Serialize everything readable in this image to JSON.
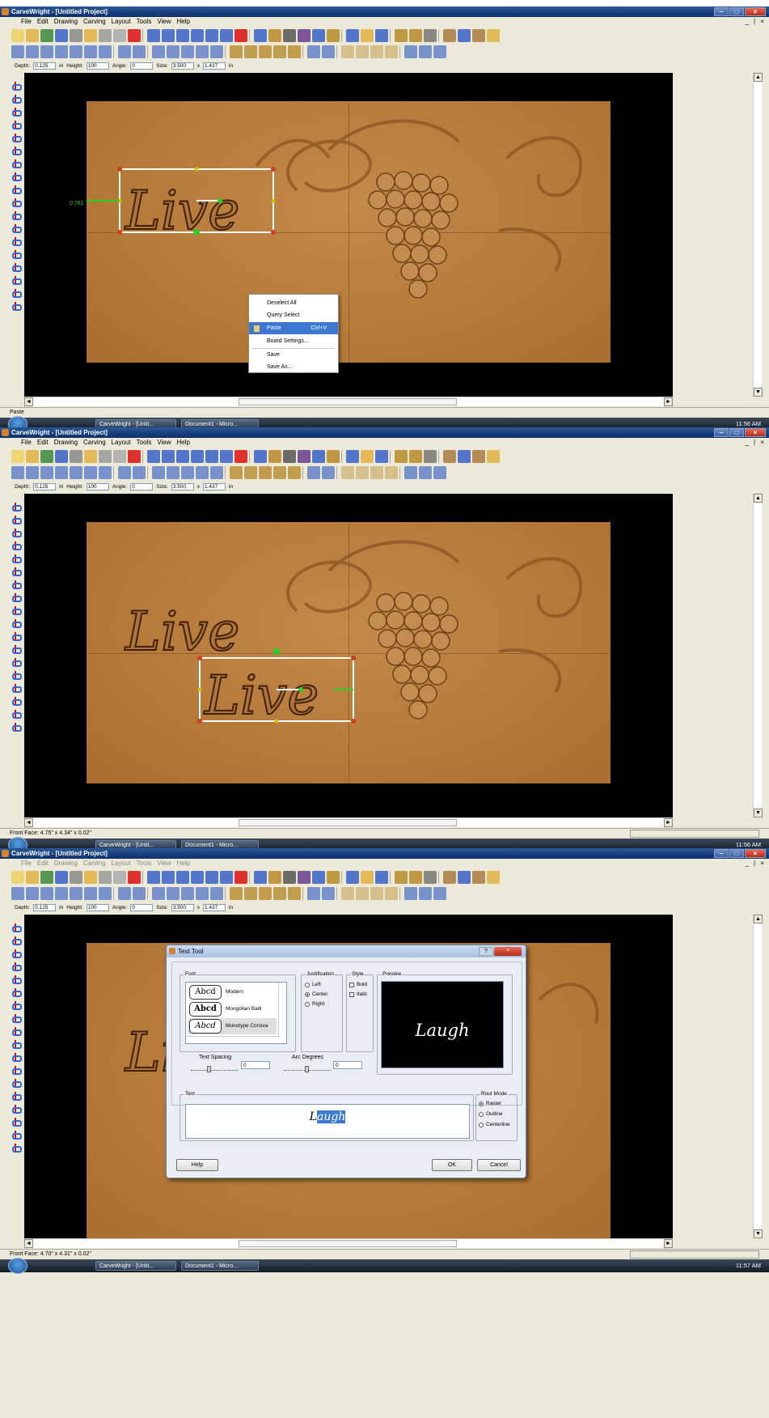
{
  "app": {
    "title": "CarveWright - [Untitled Project]",
    "menus": [
      "File",
      "Edit",
      "Drawing",
      "Carving",
      "Layout",
      "Tools",
      "View",
      "Help"
    ],
    "mdi_controls": "_ | × ",
    "win_min": "‒",
    "win_max": "□",
    "win_close": "×"
  },
  "propbar": {
    "depth_label": "Depth:",
    "depth_value": "0.125",
    "depth_unit": "in",
    "height_label": "Height:",
    "height_value": "100",
    "angle_label": "Angle:",
    "angle_value": "0",
    "size_label": "Size:",
    "size_w": "3.500",
    "size_x": "x",
    "size_h": "1.437",
    "size_unit": "in"
  },
  "panel1": {
    "measure_label": "0.761",
    "board_text": "Live",
    "context_menu": [
      {
        "label": "Deselect All"
      },
      {
        "label": "Query Select"
      },
      {
        "label": "Paste",
        "shortcut": "Ctrl+V"
      },
      {
        "label": "Board Settings..."
      },
      {
        "label": "Save"
      },
      {
        "label": "Save As..."
      }
    ],
    "status": "Paste",
    "clock": "11:56 AM"
  },
  "panel2": {
    "board_text_1": "Live",
    "board_text_2": "Live",
    "status": "Front Face: 4.75\" x 4.34\" x 0.02\"",
    "clock": "11:56 AM"
  },
  "panel3": {
    "board_text": "Live",
    "status": "Front Face: 4.70\" x 4.31\" x 0.02\"",
    "clock": "11:57 AM",
    "dialog": {
      "title": "Text Tool",
      "help_glyph": "?",
      "close_glyph": "×",
      "font_group": "Font",
      "fonts": [
        {
          "swatch": "Abcd",
          "name": "Modern"
        },
        {
          "swatch": "Abcd",
          "name": "Mongolian Baiti"
        },
        {
          "swatch": "Abcd",
          "name": "Monotype Corsiva"
        }
      ],
      "justification_group": "Justification",
      "justification": [
        "Left",
        "Center",
        "Right"
      ],
      "style_group": "Style",
      "styles": [
        "Bold",
        "Italic"
      ],
      "preview_group": "Preview",
      "preview_text": "Laugh",
      "text_spacing_label": "Text Spacing",
      "text_spacing_value": "0",
      "arc_label": "Arc Degrees",
      "arc_value": "0",
      "text_group": "Text",
      "text_value_prefix": "L",
      "text_value_selected": "augh",
      "rout_group": "Rout Mode",
      "rout_modes": [
        "Raster",
        "Outline",
        "Centerline"
      ],
      "help_button": "Help",
      "ok_button": "OK",
      "cancel_button": "Cancel"
    }
  },
  "taskbar": {
    "task1": "CarveWright - [Untit...",
    "task2": "Document1 - Micro..."
  },
  "colors": {
    "board": "#b27635",
    "selection": "#ffffff",
    "handle": "#d13b1e",
    "accent": "#3b78d4"
  }
}
